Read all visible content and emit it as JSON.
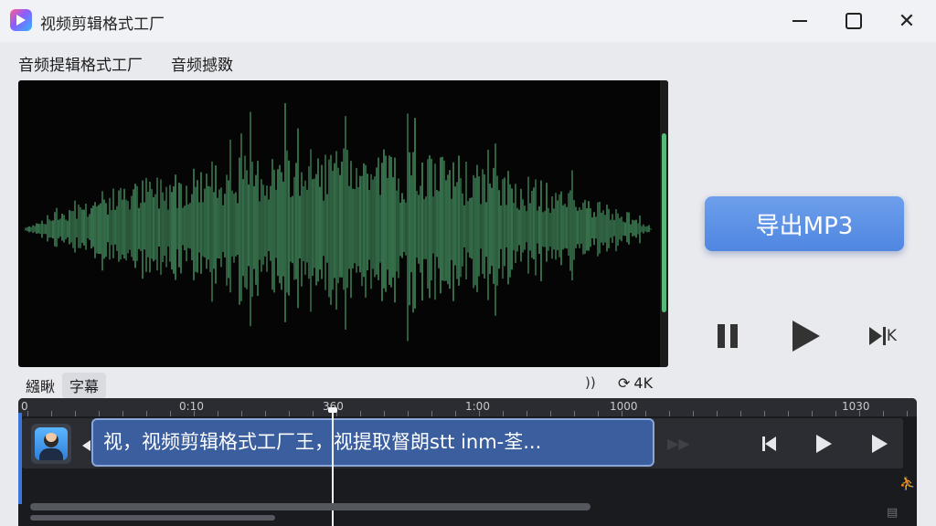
{
  "window": {
    "title": "视频剪辑格式工厂",
    "icons": {
      "app": "app-logo-icon",
      "minimize": "minimize-icon",
      "maximize": "maximize-icon",
      "close": "close-icon"
    }
  },
  "menu": {
    "items": [
      "音频提辑格式工厂",
      "音频撼敪"
    ]
  },
  "waveform": {
    "color": "#58b97b",
    "background": "#050505"
  },
  "export": {
    "label": "导出MP3",
    "color": "#5a8fe6"
  },
  "playback": {
    "next_suffix": "K",
    "icons": {
      "pause": "pause-icon",
      "play": "play-icon",
      "next": "skip-next-icon"
    }
  },
  "subtabs": {
    "items": [
      "繦瞅",
      "字幕"
    ],
    "active": 1
  },
  "status": {
    "volume_glyph": "))",
    "quality_glyph": "⟳",
    "quality_label": "4K"
  },
  "timeline": {
    "ruler_labels": [
      "0",
      "0:10",
      "360",
      "1:00",
      "1000",
      "1030"
    ],
    "subtitle_text": "视，视频剪辑格式工厂王，视提取督朗stt inm-荃...",
    "ghost_glyph": "▶▶",
    "side_glyphs": [
      "⛹",
      "▤"
    ],
    "clip_color": "#3b5e9f",
    "icons": {
      "avatar": "speaker-avatar-icon",
      "prev": "skip-back-icon",
      "play": "play-icon",
      "forward": "forward-icon"
    }
  }
}
